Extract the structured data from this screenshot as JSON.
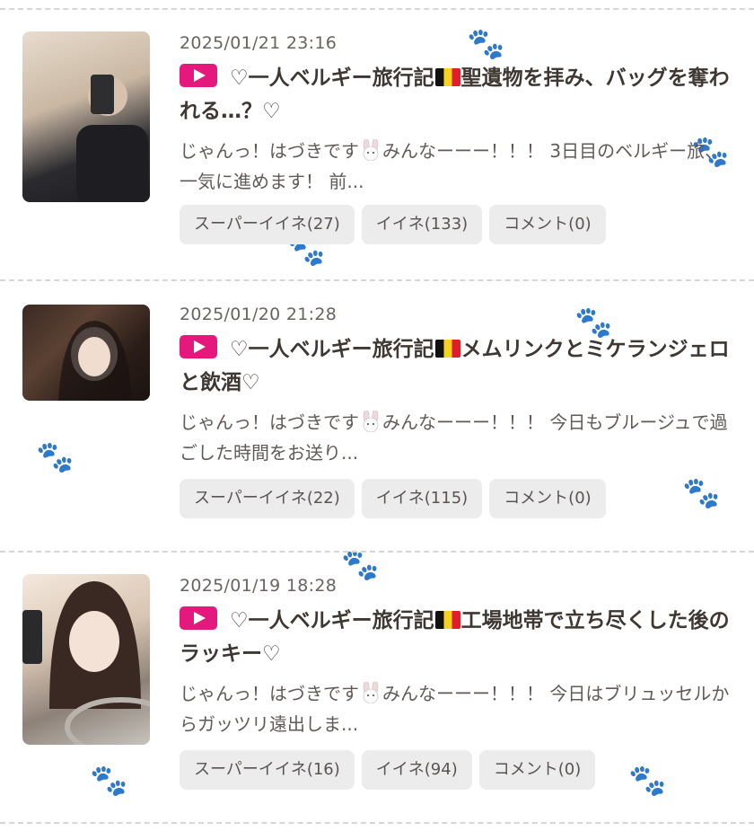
{
  "posts": [
    {
      "date": "2025/01/21 23:16",
      "title_a": "♡一人ベルギー旅行記",
      "title_b": "聖遺物を拝み、バッグを奪われる…？♡",
      "excerpt_a": "じゃんっ！はづきです",
      "excerpt_b": "みんなーーー！！！ 3日目のベルギー旅、一気に進めます！ 前...",
      "tags": [
        "スーパーイイネ(27)",
        "イイネ(133)",
        "コメント(0)"
      ]
    },
    {
      "date": "2025/01/20 21:28",
      "title_a": "♡一人ベルギー旅行記",
      "title_b": "メムリンクとミケランジェロと飲酒♡",
      "excerpt_a": "じゃんっ！はづきです",
      "excerpt_b": "みんなーーー！！！ 今日もブルージュで過ごした時間をお送り...",
      "tags": [
        "スーパーイイネ(22)",
        "イイネ(115)",
        "コメント(0)"
      ]
    },
    {
      "date": "2025/01/19 18:28",
      "title_a": "♡一人ベルギー旅行記",
      "title_b": "工場地帯で立ち尽くした後のラッキー♡",
      "excerpt_a": "じゃんっ！はづきです",
      "excerpt_b": "みんなーーー！！！ 今日はブリュッセルからガッツリ遠出しま...",
      "tags": [
        "スーパーイイネ(16)",
        "イイネ(94)",
        "コメント(0)"
      ]
    }
  ],
  "icons": {
    "play": "play-badge-icon",
    "flag": "belgium-flag-icon",
    "emoji": "rabbit-face-icon"
  },
  "colors": {
    "play_badge": "#e5197d",
    "tag_bg": "#ececec",
    "divider": "#d9d5d5"
  }
}
